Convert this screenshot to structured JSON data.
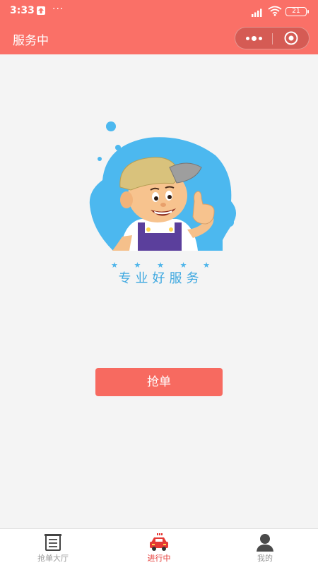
{
  "status_bar": {
    "time": "3:33",
    "dots": "···",
    "battery": "21"
  },
  "nav": {
    "title": "服务中"
  },
  "hero": {
    "stars": [
      "★",
      "★",
      "★",
      "★",
      "★"
    ],
    "slogan": "专业好服务"
  },
  "main": {
    "grab_label": "抢单"
  },
  "tabs": [
    {
      "label": "抢单大厅",
      "icon": "order-list-icon",
      "active": false
    },
    {
      "label": "进行中",
      "icon": "car-icon",
      "active": true
    },
    {
      "label": "我的",
      "icon": "person-icon",
      "active": false
    }
  ],
  "colors": {
    "brand": "#fa7067",
    "button": "#f76a60",
    "slogan": "#3ea8e0",
    "active_tab": "#e53935"
  }
}
